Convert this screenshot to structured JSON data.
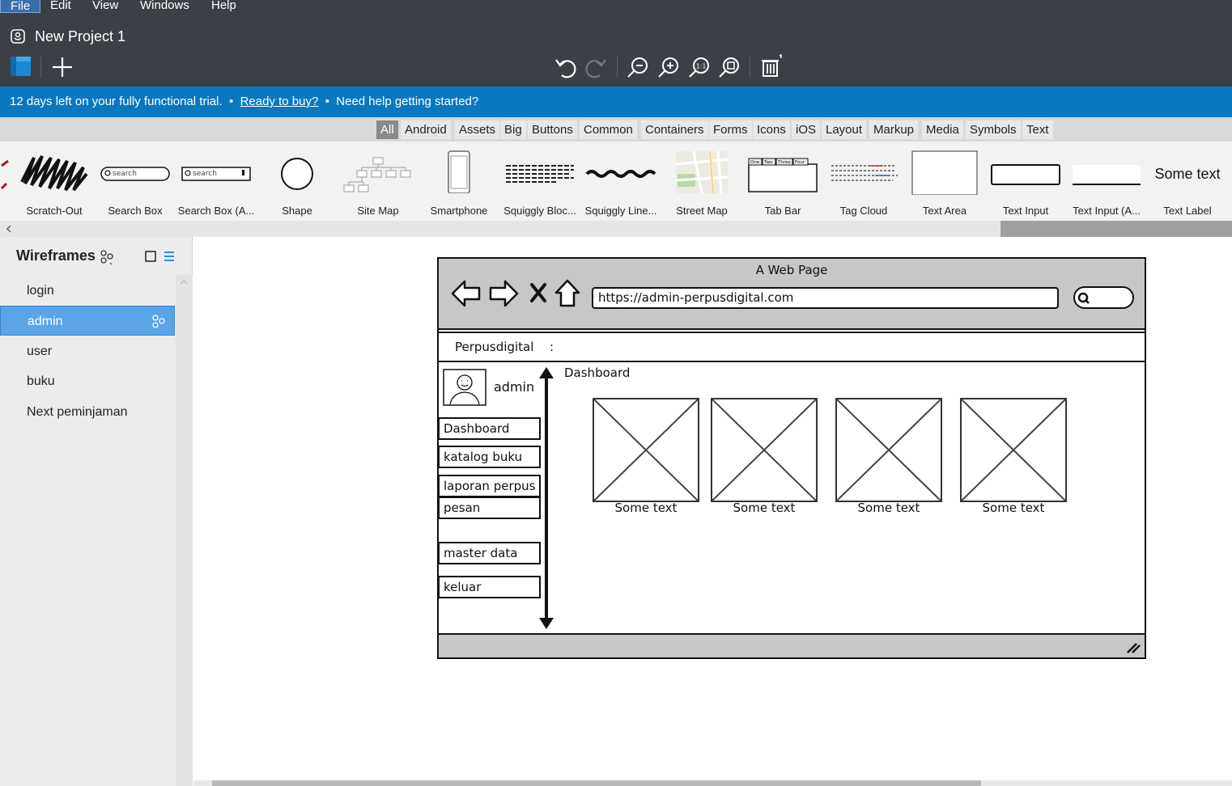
{
  "menu": [
    "File",
    "Edit",
    "View",
    "Windows",
    "Help"
  ],
  "project": {
    "title": "New Project 1"
  },
  "trial": {
    "message": "12 days left on your fully functional trial.",
    "sep": "•",
    "buy_link": "Ready to buy?",
    "help": "Need help getting started?"
  },
  "library_tabs": [
    "All",
    "Android",
    "Assets",
    "Big",
    "Buttons",
    "Common",
    "Containers",
    "Forms",
    "Icons",
    "iOS",
    "Layout",
    "Markup",
    "Media",
    "Symbols",
    "Text"
  ],
  "components": [
    {
      "label": "Scratch-Out",
      "icon": "scratch-out-icon"
    },
    {
      "label": "Search Box",
      "icon": "search-box-icon",
      "placeholder": "search"
    },
    {
      "label": "Search Box (A...",
      "icon": "search-box-alt-icon",
      "placeholder": "search"
    },
    {
      "label": "Shape",
      "icon": "circle-shape-icon"
    },
    {
      "label": "Site Map",
      "icon": "site-map-icon"
    },
    {
      "label": "Smartphone",
      "icon": "smartphone-icon"
    },
    {
      "label": "Squiggly Bloc...",
      "icon": "squiggly-block-icon"
    },
    {
      "label": "Squiggly Line...",
      "icon": "squiggly-line-icon"
    },
    {
      "label": "Street Map",
      "icon": "street-map-icon"
    },
    {
      "label": "Tab Bar",
      "icon": "tab-bar-icon",
      "tabs": [
        "One",
        "Two",
        "Three",
        "Four"
      ]
    },
    {
      "label": "Tag Cloud",
      "icon": "tag-cloud-icon"
    },
    {
      "label": "Text Area",
      "icon": "text-area-icon"
    },
    {
      "label": "Text Input",
      "icon": "text-input-icon"
    },
    {
      "label": "Text Input (A...",
      "icon": "text-input-alt-icon"
    },
    {
      "label": "Text Label",
      "icon": "text-label-icon",
      "sample": "Some text"
    }
  ],
  "wireframes": {
    "title": "Wireframes",
    "items": [
      "login",
      "admin",
      "user",
      "buku",
      "Next peminjaman"
    ],
    "selected": "admin"
  },
  "mockup": {
    "browser_title": "A Web Page",
    "url": "https://admin-perpusdigital.com",
    "header_text": "Perpusdigital",
    "header_sep": ":",
    "user_name": "admin",
    "nav": [
      "Dashboard",
      "katalog buku",
      "laporan perpus",
      "pesan",
      "master data",
      "keluar"
    ],
    "content_title": "Dashboard",
    "cards": [
      "Some text",
      "Some text",
      "Some text",
      "Some text"
    ]
  },
  "colors": {
    "chrome": "#3b4046",
    "trial_bar": "#0a78c0",
    "selection": "#5aa5e8"
  }
}
